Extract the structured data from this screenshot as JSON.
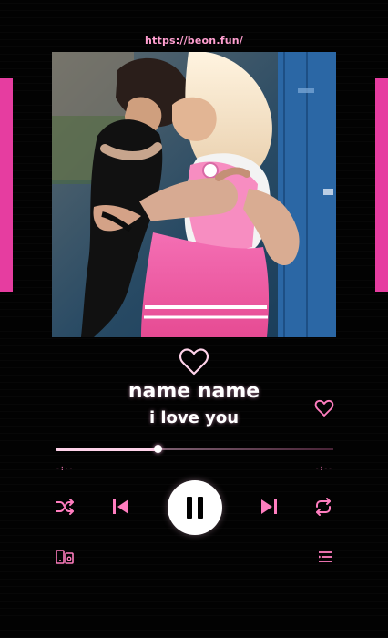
{
  "url": "https://beon.fun/",
  "song": {
    "title": "name name",
    "subtitle": "i love you"
  },
  "progress": {
    "fraction": 0.37,
    "elapsed": "-:--",
    "remaining": "-:--"
  },
  "colors": {
    "accent": "#e63da0",
    "accent_light": "#ff7dbf",
    "text": "#ffffff",
    "background": "#020202"
  },
  "icons": {
    "top_heart": "heart-outline-icon",
    "like": "heart-outline-icon",
    "shuffle": "shuffle-icon",
    "previous": "skip-previous-icon",
    "pause": "pause-icon",
    "next": "skip-next-icon",
    "repeat": "repeat-icon",
    "devices": "devices-icon",
    "queue": "queue-icon"
  }
}
